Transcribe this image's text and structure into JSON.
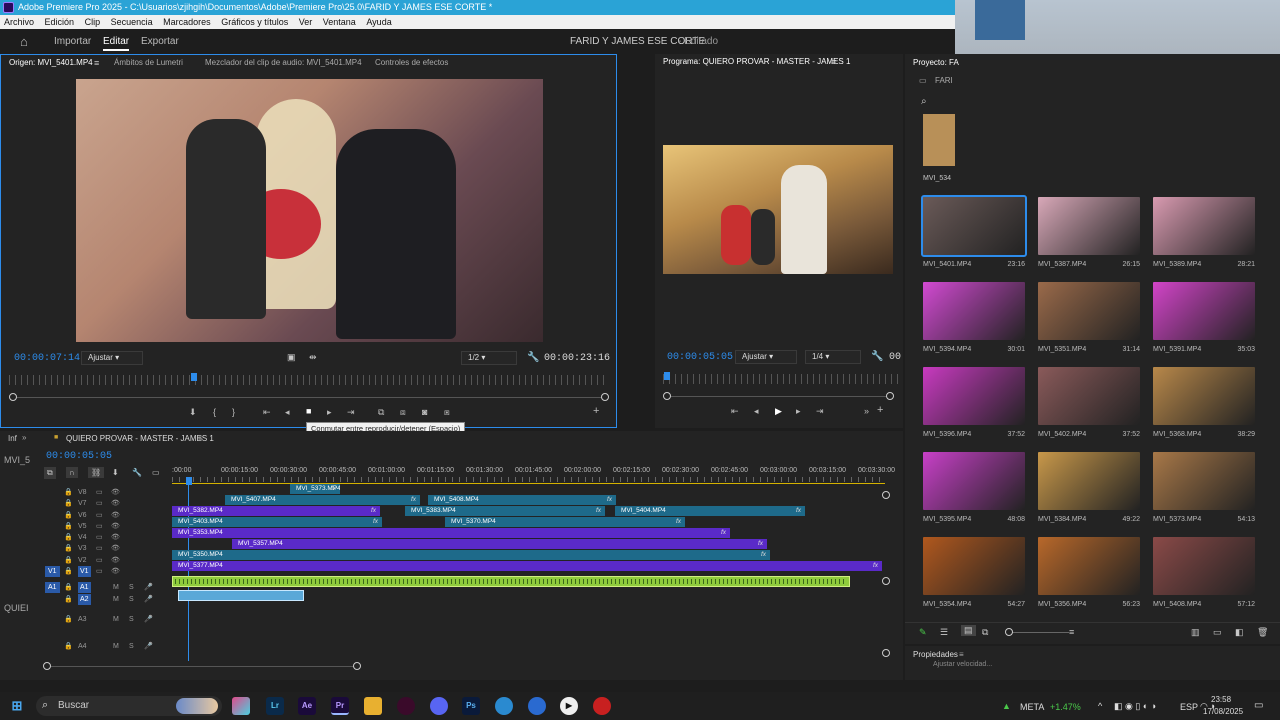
{
  "window_title": "Adobe Premiere Pro 2025 - C:\\Usuarios\\zjihgih\\Documentos\\Adobe\\Premiere Pro\\25.0\\FARID Y JAMES ESE CORTE *",
  "menu": [
    "Archivo",
    "Edición",
    "Clip",
    "Secuencia",
    "Marcadores",
    "Gráficos y títulos",
    "Ver",
    "Ventana",
    "Ayuda"
  ],
  "header": {
    "import": "Importar",
    "edit": "Editar",
    "export": "Exportar",
    "project_title": "FARID Y JAMES ESE CORTE",
    "project_status": "- Editado"
  },
  "source": {
    "tabs": [
      "Origen: MVI_5401.MP4",
      "Ámbitos de Lumetri",
      "Mezclador del clip de audio: MVI_5401.MP4",
      "Controles de efectos"
    ],
    "timecode": "00:00:07:14",
    "fit": "Ajustar",
    "res": "1/2",
    "duration": "00:00:23:16",
    "tooltip": "Conmutar entre reproducir/detener (Espacio)"
  },
  "program": {
    "title": "Programa: QUIERO PROVAR - MASTER - JAMES 1",
    "timecode": "00:00:05:05",
    "fit": "Ajustar",
    "res": "1/4",
    "duration_partial": "00"
  },
  "timeline": {
    "panel_short": "Inf",
    "seq_tab": "QUIERO PROVAR - MASTER - JAMES 1",
    "side_label": "MVI_5",
    "side_label2": "QUIEI",
    "timecode": "00:00:05:05",
    "ruler": [
      ":00:00",
      "00:00:15:00",
      "00:00:30:00",
      "00:00:45:00",
      "00:01:00:00",
      "00:01:15:00",
      "00:01:30:00",
      "00:01:45:00",
      "00:02:00:00",
      "00:02:15:00",
      "00:02:30:00",
      "00:02:45:00",
      "00:03:00:00",
      "00:03:15:00",
      "00:03:30:00"
    ],
    "tracks": [
      "V8",
      "V7",
      "V6",
      "V5",
      "V4",
      "V3",
      "V2",
      "V1",
      "A1",
      "A2",
      "A3",
      "A4"
    ],
    "fx": "fx",
    "tmark": "M",
    "smark": "S",
    "clips": [
      {
        "label": "MVI_5373.MP4"
      },
      {
        "label": "MVI_5407.MP4"
      },
      {
        "label": "MVI_5408.MP4"
      },
      {
        "label": "MVI_5382.MP4"
      },
      {
        "label": "MVI_5383.MP4"
      },
      {
        "label": "MVI_5404.MP4"
      },
      {
        "label": "MVI_5403.MP4"
      },
      {
        "label": "MVI_5370.MP4"
      },
      {
        "label": "MVI_5353.MP4"
      },
      {
        "label": "MVI_5357.MP4"
      },
      {
        "label": "MVI_5350.MP4"
      },
      {
        "label": "MVI_5377.MP4"
      }
    ]
  },
  "project": {
    "tab": "Proyecto: FA",
    "folder": "FARI",
    "partial_item": "MVI_534",
    "items": [
      {
        "name": "MVI_5401.MP4",
        "dur": "23:16",
        "color": "#6a5a58"
      },
      {
        "name": "MVI_5387.MP4",
        "dur": "26:15",
        "color": "#d8a8b8"
      },
      {
        "name": "MVI_5389.MP4",
        "dur": "28:21",
        "color": "#d89ab0"
      },
      {
        "name": "MVI_5394.MP4",
        "dur": "30:01",
        "color": "#d24ad2"
      },
      {
        "name": "MVI_5351.MP4",
        "dur": "31:14",
        "color": "#9a6a4a"
      },
      {
        "name": "MVI_5391.MP4",
        "dur": "35:03",
        "color": "#d244c8"
      },
      {
        "name": "MVI_5396.MP4",
        "dur": "37:52",
        "color": "#c83ac0"
      },
      {
        "name": "MVI_5402.MP4",
        "dur": "37:52",
        "color": "#8a5a5a"
      },
      {
        "name": "MVI_5368.MP4",
        "dur": "38:29",
        "color": "#b8884a"
      },
      {
        "name": "MVI_5395.MP4",
        "dur": "48:08",
        "color": "#c840c8"
      },
      {
        "name": "MVI_5384.MP4",
        "dur": "49:22",
        "color": "#c8984a"
      },
      {
        "name": "MVI_5373.MP4",
        "dur": "54:13",
        "color": "#a87848"
      },
      {
        "name": "MVI_5354.MP4",
        "dur": "54:27",
        "color": "#b0581e"
      },
      {
        "name": "MVI_5356.MP4",
        "dur": "56:23",
        "color": "#b8682a"
      },
      {
        "name": "MVI_5408.MP4",
        "dur": "57:12",
        "color": "#8a4a48"
      }
    ]
  },
  "properties": {
    "title": "Propiedades",
    "item": "Ajustar velocidad..."
  },
  "taskbar": {
    "search": "Buscar",
    "stock": "META",
    "stock_change": "+1.47%",
    "lang": "ESP",
    "time": "23:58",
    "date": "17/08/2025"
  },
  "icons": [
    "home-icon",
    "search-icon",
    "selection-tool-icon",
    "track-select-icon",
    "ripple-icon",
    "razor-icon",
    "slip-icon",
    "pen-icon",
    "rect-icon",
    "hand-icon",
    "type-icon",
    "windows-start-icon"
  ]
}
